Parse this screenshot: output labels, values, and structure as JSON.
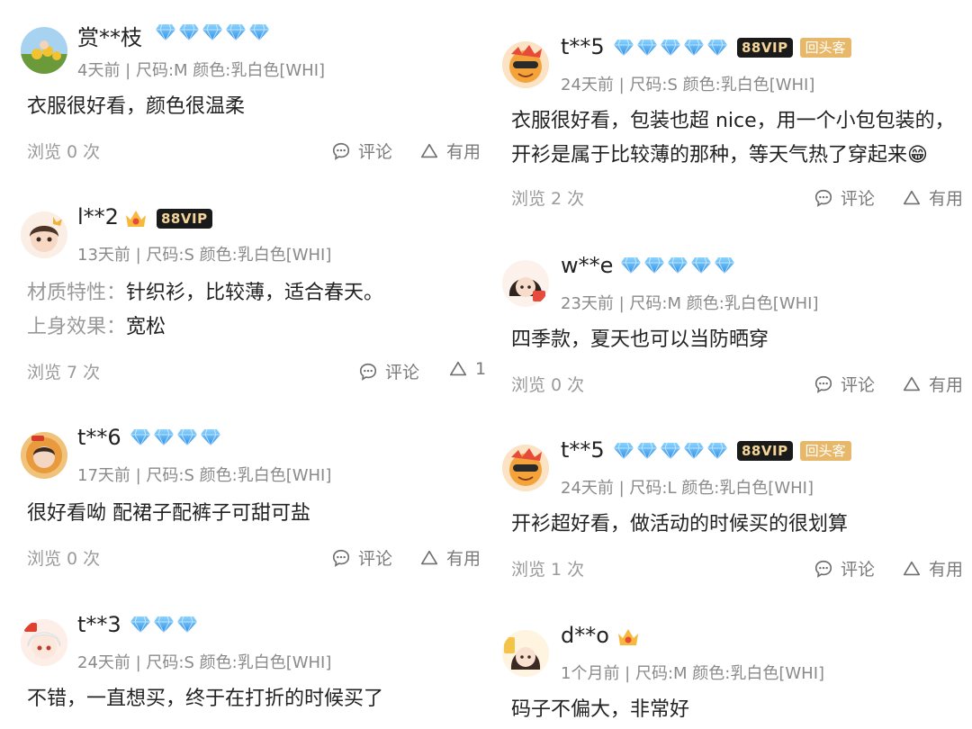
{
  "left": [
    {
      "nickname": "赏**枝",
      "meta": "4天前 | 尺码:M 颜色:乳白色[WHI]",
      "diamonds": 5,
      "lines": [
        {
          "label": "",
          "text": "衣服很好看，颜色很温柔"
        }
      ],
      "views": "浏览 0 次",
      "comment": "评论",
      "useful": "有用"
    },
    {
      "nickname": "l**2",
      "meta": "13天前 | 尺码:S 颜色:乳白色[WHI]",
      "vip": "88VIP",
      "lines": [
        {
          "label": "材质特性：",
          "text": "针织衫，比较薄，适合春天。"
        },
        {
          "label": "上身效果：",
          "text": "宽松"
        }
      ],
      "views": "浏览 7 次",
      "comment": "评论",
      "useful": "1"
    },
    {
      "nickname": "t**6",
      "meta": "17天前 | 尺码:S 颜色:乳白色[WHI]",
      "diamonds": 4,
      "lines": [
        {
          "label": "",
          "text": "很好看呦 配裙子配裤子可甜可盐"
        }
      ],
      "views": "浏览 0 次",
      "comment": "评论",
      "useful": "有用"
    },
    {
      "nickname": "t**3",
      "meta": "24天前 | 尺码:S 颜色:乳白色[WHI]",
      "diamonds": 3,
      "lines": [
        {
          "label": "",
          "text": "不错，一直想买，终于在打折的时候买了"
        }
      ]
    }
  ],
  "right": [
    {
      "nickname": "t**5",
      "meta": "24天前 | 尺码:S 颜色:乳白色[WHI]",
      "diamonds": 5,
      "vip": "88VIP",
      "returning": "回头客",
      "lines": [
        {
          "label": "",
          "text": "衣服很好看，包装也超 nice，用一个小包包装的，"
        },
        {
          "label": "",
          "text": "开衫是属于比较薄的那种，等天气热了穿起来😁"
        }
      ],
      "views": "浏览 2 次",
      "comment": "评论",
      "useful": "有用"
    },
    {
      "nickname": "w**e",
      "meta": "23天前 | 尺码:M 颜色:乳白色[WHI]",
      "diamonds": 5,
      "lines": [
        {
          "label": "",
          "text": "四季款，夏天也可以当防晒穿"
        }
      ],
      "views": "浏览 0 次",
      "comment": "评论",
      "useful": "有用"
    },
    {
      "nickname": "t**5",
      "meta": "24天前 | 尺码:L 颜色:乳白色[WHI]",
      "diamonds": 5,
      "vip": "88VIP",
      "returning": "回头客",
      "lines": [
        {
          "label": "",
          "text": "开衫超好看，做活动的时候买的很划算"
        }
      ],
      "views": "浏览 1 次",
      "comment": "评论",
      "useful": "有用"
    },
    {
      "nickname": "d**o",
      "meta": "1个月前 | 尺码:M 颜色:乳白色[WHI]",
      "lines": [
        {
          "label": "",
          "text": "码子不偏大，非常好"
        }
      ]
    }
  ],
  "icons": {
    "diamond": "diamond-icon",
    "crown": "crown-icon",
    "comment": "comment-bubble-icon",
    "useful": "triangle-useful-icon"
  },
  "colors": {
    "diamond": "#3da7f0",
    "vip_bg": "#1a1a1a",
    "vip_text": "#f3d59a",
    "returning_bg": "#e8b86a",
    "meta": "#8a8a8a",
    "label": "#999999"
  }
}
